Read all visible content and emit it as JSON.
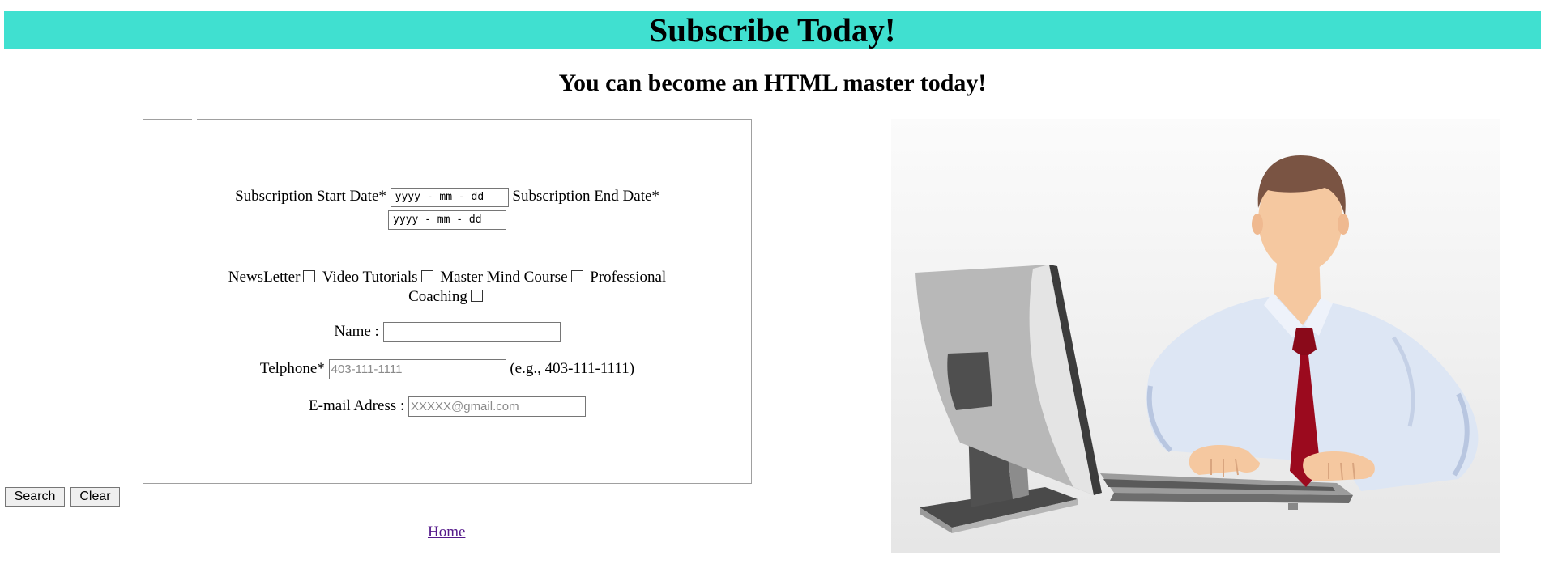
{
  "header": {
    "title": "Subscribe Today!",
    "subtitle": "You can become an HTML master today!"
  },
  "form": {
    "start_date_label": "Subscription Start Date*",
    "start_date_placeholder": "yyyy - mm - dd",
    "end_date_label": "Subscription End Date*",
    "end_date_placeholder": "yyyy - mm - dd",
    "options": [
      {
        "label": "NewsLetter",
        "checked": false
      },
      {
        "label": "Video Tutorials",
        "checked": false
      },
      {
        "label": "Master Mind Course",
        "checked": false
      },
      {
        "label": "Professional Coaching",
        "checked": false
      }
    ],
    "options_line1": {
      "newsletter": "NewsLetter",
      "video": "Video Tutorials",
      "mastermind": "Master Mind Course",
      "professional": "Professional"
    },
    "options_line2": {
      "coaching": "Coaching"
    },
    "name_label": "Name :",
    "name_value": "",
    "telephone_label": "Telphone*",
    "telephone_placeholder": "403-111-1111",
    "telephone_hint": "(e.g., 403-111-1111)",
    "email_label": "E-mail Adress :",
    "email_placeholder": "XXXXX@gmail.com"
  },
  "buttons": {
    "search": "Search",
    "clear": "Clear"
  },
  "footer": {
    "home_link": "Home"
  },
  "colors": {
    "banner": "#40e0d0",
    "link": "#551a8b",
    "tie": "#9b0a1e",
    "shirt": "#dde6f4",
    "hair": "#7a5443",
    "skin": "#f5c8a0"
  },
  "illustration": {
    "icon": "person-at-computer-illustration"
  }
}
